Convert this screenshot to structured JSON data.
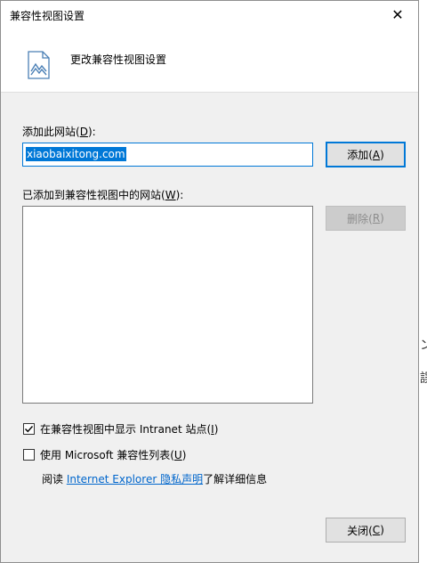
{
  "dialog": {
    "title": "兼容性视图设置",
    "close_glyph": "✕",
    "header": {
      "title": "更改兼容性视图设置"
    }
  },
  "add_site": {
    "label_prefix": "添加此网站(",
    "label_key": "D",
    "label_suffix": "):",
    "input_value": "xiaobaixitong.com",
    "add_button": {
      "prefix": "添加(",
      "key": "A",
      "suffix": ")"
    }
  },
  "added_sites": {
    "label_prefix": "已添加到兼容性视图中的网站(",
    "label_key": "W",
    "label_suffix": "):",
    "items": [],
    "remove_button": {
      "prefix": "删除(",
      "key": "R",
      "suffix": ")"
    }
  },
  "options": {
    "intranet": {
      "checked": true,
      "prefix": "在兼容性视图中显示 Intranet 站点(",
      "key": "I",
      "suffix": ")"
    },
    "ms_list": {
      "checked": false,
      "prefix": "使用 Microsoft 兼容性列表(",
      "key": "U",
      "suffix": ")"
    }
  },
  "privacy": {
    "prefix": "阅读 ",
    "link_text": "Internet Explorer 隐私声明",
    "suffix": "了解详细信息"
  },
  "footer": {
    "close_button": {
      "prefix": "关闭(",
      "key": "C",
      "suffix": ")"
    }
  },
  "background": {
    "fragment1": "ン",
    "fragment2": "誤"
  },
  "colors": {
    "accent": "#0078d7",
    "link": "#0066cc"
  }
}
